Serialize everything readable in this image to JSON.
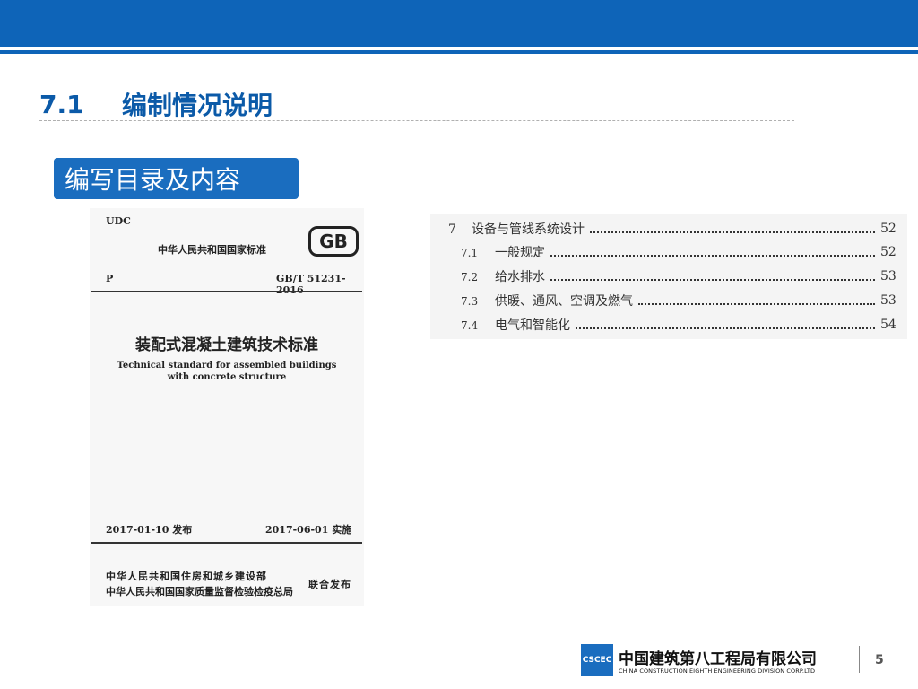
{
  "header": {
    "colors": {
      "bar": "#0e64b8"
    }
  },
  "section": {
    "number": "7.1",
    "title": "编制情况说明"
  },
  "badge": {
    "label": "编写目录及内容"
  },
  "cover": {
    "udc": "UDC",
    "org_top": "中华人民共和国国家标准",
    "logo": "GB",
    "p_label": "P",
    "code": "GB/T 51231-2016",
    "title_cn": "装配式混凝土建筑技术标准",
    "title_en_line1": "Technical standard for assembled buildings",
    "title_en_line2": "with concrete structure",
    "issue_date": "2017-01-10  发布",
    "impl_date": "2017-06-01  实施",
    "issuer1": "中华人民共和国住房和城乡建设部",
    "issuer2": "中华人民共和国国家质量监督检验检疫总局",
    "joint": "联合发布"
  },
  "toc": {
    "rows": [
      {
        "code": "7",
        "title": "设备与管线系统设计",
        "page": "52"
      },
      {
        "code": "7.1",
        "title": "一般规定",
        "page": "52"
      },
      {
        "code": "7.2",
        "title": "给水排水",
        "page": "53"
      },
      {
        "code": "7.3",
        "title": "供暖、通风、空调及燃气",
        "page": "53"
      },
      {
        "code": "7.4",
        "title": "电气和智能化",
        "page": "54"
      }
    ]
  },
  "footer": {
    "logo_text": "CSCEC",
    "company_cn": "中国建筑第八工程局有限公司",
    "company_en": "CHINA CONSTRUCTION EIGHTH ENGINEERING DIVISION CORP.LTD",
    "page": "5"
  }
}
